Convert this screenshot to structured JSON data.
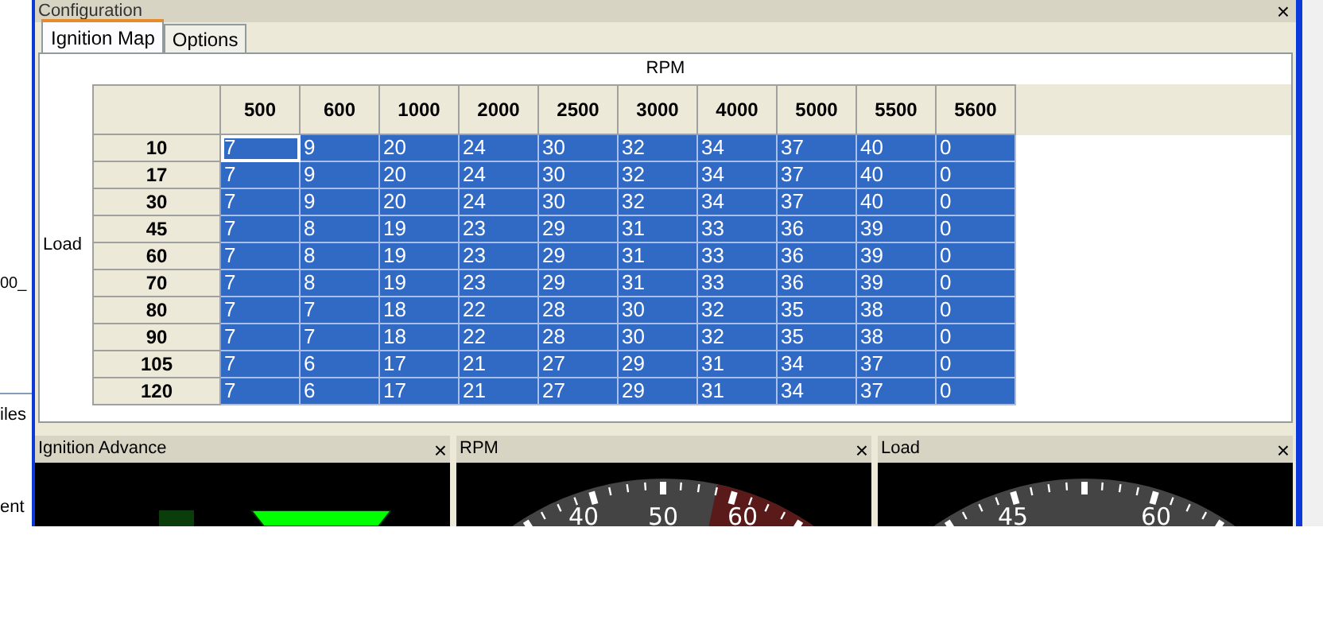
{
  "background_texts": [
    "00_",
    "iles",
    "ent"
  ],
  "window": {
    "title": "Configuration",
    "close": "×"
  },
  "tabs": [
    {
      "label": "Ignition Map",
      "selected": true
    },
    {
      "label": "Options",
      "selected": false
    }
  ],
  "table": {
    "column_axis": "RPM",
    "row_axis": "Load",
    "columns": [
      "500",
      "600",
      "1000",
      "2000",
      "2500",
      "3000",
      "4000",
      "5000",
      "5500",
      "5600"
    ],
    "rows": [
      {
        "label": "10",
        "selected": true,
        "focused": true,
        "cells": [
          "7",
          "9",
          "20",
          "24",
          "30",
          "32",
          "34",
          "37",
          "40",
          "0"
        ]
      },
      {
        "label": "17",
        "selected": true,
        "focused": false,
        "cells": [
          "7",
          "9",
          "20",
          "24",
          "30",
          "32",
          "34",
          "37",
          "40",
          "0"
        ]
      },
      {
        "label": "30",
        "selected": true,
        "focused": false,
        "cells": [
          "7",
          "9",
          "20",
          "24",
          "30",
          "32",
          "34",
          "37",
          "40",
          "0"
        ]
      },
      {
        "label": "45",
        "selected": true,
        "focused": false,
        "cells": [
          "7",
          "8",
          "19",
          "23",
          "29",
          "31",
          "33",
          "36",
          "39",
          "0"
        ]
      },
      {
        "label": "60",
        "selected": true,
        "focused": false,
        "cells": [
          "7",
          "8",
          "19",
          "23",
          "29",
          "31",
          "33",
          "36",
          "39",
          "0"
        ]
      },
      {
        "label": "70",
        "selected": true,
        "focused": false,
        "cells": [
          "7",
          "8",
          "19",
          "23",
          "29",
          "31",
          "33",
          "36",
          "39",
          "0"
        ]
      },
      {
        "label": "80",
        "selected": true,
        "focused": false,
        "cells": [
          "7",
          "7",
          "18",
          "22",
          "28",
          "30",
          "32",
          "35",
          "38",
          "0"
        ]
      },
      {
        "label": "90",
        "selected": true,
        "focused": false,
        "cells": [
          "7",
          "7",
          "18",
          "22",
          "28",
          "30",
          "32",
          "35",
          "38",
          "0"
        ]
      },
      {
        "label": "105",
        "selected": true,
        "focused": false,
        "cells": [
          "7",
          "6",
          "17",
          "21",
          "27",
          "29",
          "31",
          "34",
          "37",
          "0"
        ]
      },
      {
        "label": "120",
        "selected": true,
        "focused": false,
        "cells": [
          "7",
          "6",
          "17",
          "21",
          "27",
          "29",
          "31",
          "34",
          "37",
          "0"
        ]
      }
    ]
  },
  "gauges": [
    {
      "kind": "bars",
      "title": "Ignition Advance",
      "close": "×"
    },
    {
      "kind": "dial",
      "title": "RPM",
      "close": "×",
      "labels": [
        "40",
        "50",
        "60"
      ],
      "redline": true
    },
    {
      "kind": "dial",
      "title": "Load",
      "close": "×",
      "labels": [
        "45",
        "60"
      ],
      "redline": false
    }
  ]
}
